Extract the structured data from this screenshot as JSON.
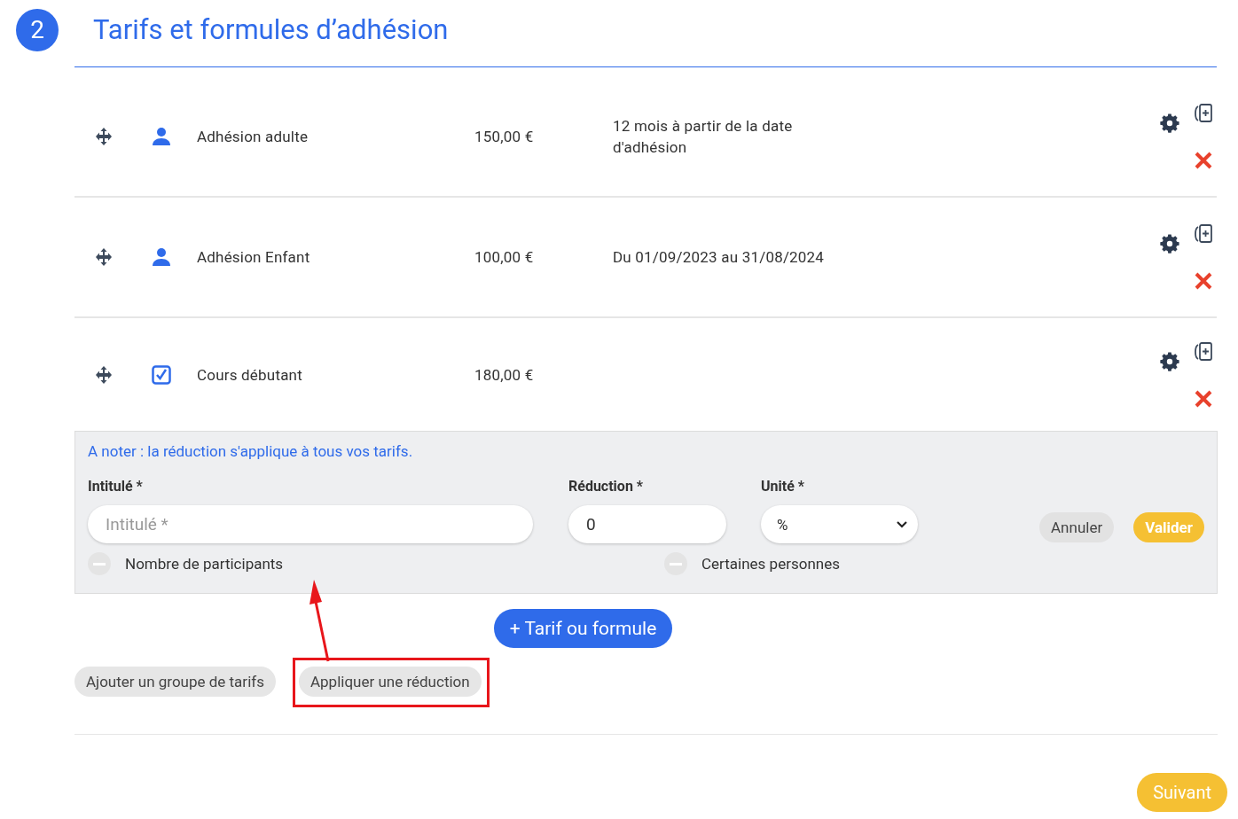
{
  "header": {
    "step": "2",
    "title": "Tarifs et formules d’adhésion"
  },
  "tariffs": [
    {
      "kind": "membership",
      "name": "Adhésion adulte",
      "price": "150,00 €",
      "period": "12 mois à partir de la date d'adhésion"
    },
    {
      "kind": "membership",
      "name": "Adhésion Enfant",
      "price": "100,00 €",
      "period": "Du 01/09/2023 au 31/08/2024"
    },
    {
      "kind": "course",
      "name": "Cours débutant",
      "price": "180,00 €"
    }
  ],
  "reduction_panel": {
    "note": "A noter : la réduction s'applique à tous vos tarifs.",
    "label_field": {
      "label": "Intitulé *",
      "placeholder": "Intitulé *"
    },
    "amount_field": {
      "label": "Réduction *",
      "value": "0"
    },
    "unit_field": {
      "label": "Unité *",
      "value": "%"
    },
    "buttons": {
      "cancel": "Annuler",
      "confirm": "Valider"
    },
    "toggles": [
      {
        "label": "Nombre de participants",
        "on": false
      },
      {
        "label": "Certaines personnes",
        "on": false
      }
    ]
  },
  "add_button": "+ Tarif ou formule",
  "secondary_buttons": [
    {
      "label": "Ajouter un groupe de tarifs",
      "highlighted": false
    },
    {
      "label": "Appliquer une réduction",
      "highlighted": true
    }
  ],
  "next_button": "Suivant"
}
